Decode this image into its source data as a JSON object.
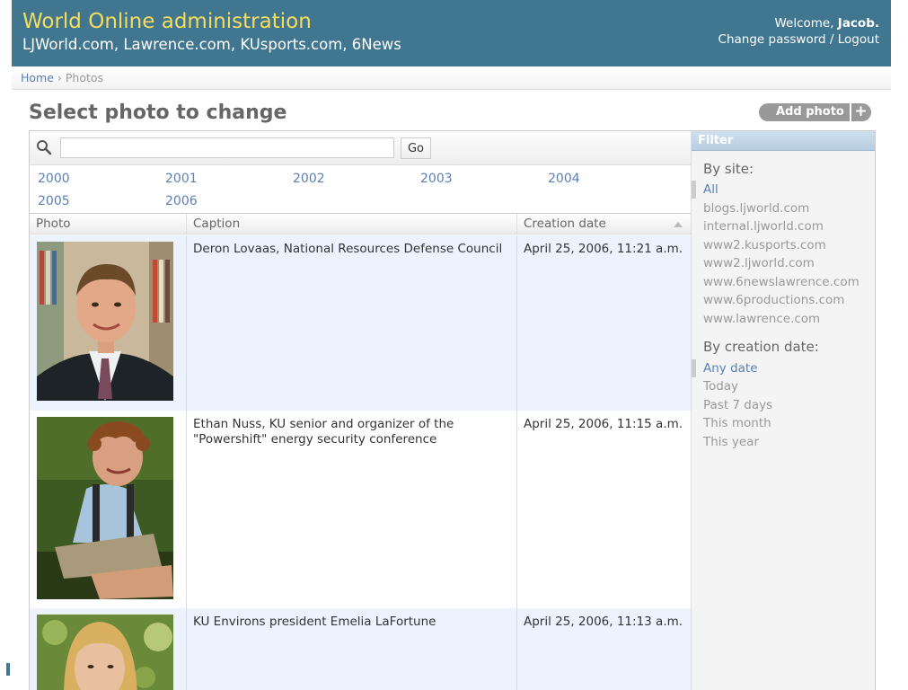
{
  "header": {
    "title": "World Online administration",
    "subtitle": "LJWorld.com, Lawrence.com, KUsports.com, 6News",
    "welcome_prefix": "Welcome,",
    "username": "Jacob.",
    "change_password": "Change password",
    "separator": " / ",
    "logout": "Logout"
  },
  "breadcrumbs": {
    "home": "Home",
    "separator": " › ",
    "current": "Photos"
  },
  "page_title": "Select photo to change",
  "add_button": {
    "label": "Add photo",
    "plus": "+"
  },
  "search": {
    "value": "",
    "placeholder": "",
    "go_label": "Go"
  },
  "date_hierarchy": [
    "2000",
    "2001",
    "2002",
    "2003",
    "2004",
    "2005",
    "2006"
  ],
  "table": {
    "columns": [
      "Photo",
      "Caption",
      "Creation date"
    ],
    "sorted_column": "Creation date",
    "sort_direction": "ascending",
    "rows": [
      {
        "caption": "Deron Lovaas, National Resources Defense Council",
        "date": "April 25, 2006, 11:21 a.m.",
        "photo_icon": "portrait-man-suit"
      },
      {
        "caption": "Ethan Nuss, KU senior and organizer of the \"Powershift\" energy security conference",
        "date": "April 25, 2006, 11:15 a.m.",
        "photo_icon": "portrait-man-curly-hair"
      },
      {
        "caption": "KU Environs president Emelia LaFortune",
        "date": "April 25, 2006, 11:13 a.m.",
        "photo_icon": "portrait-woman"
      }
    ]
  },
  "filter": {
    "title": "Filter",
    "by_site": {
      "heading": "By site:",
      "options": [
        "All",
        "blogs.ljworld.com",
        "internal.ljworld.com",
        "www2.kusports.com",
        "www2.ljworld.com",
        "www.6newslawrence.com",
        "www.6productions.com",
        "www.lawrence.com"
      ],
      "selected": "All"
    },
    "by_date": {
      "heading": "By creation date:",
      "options": [
        "Any date",
        "Today",
        "Past 7 days",
        "This month",
        "This year"
      ],
      "selected": "Any date"
    }
  },
  "colors": {
    "header_bg": "#417690",
    "header_title": "#f5dd5d",
    "link": "#5b80b2",
    "row_alt": "#edf3fe"
  }
}
